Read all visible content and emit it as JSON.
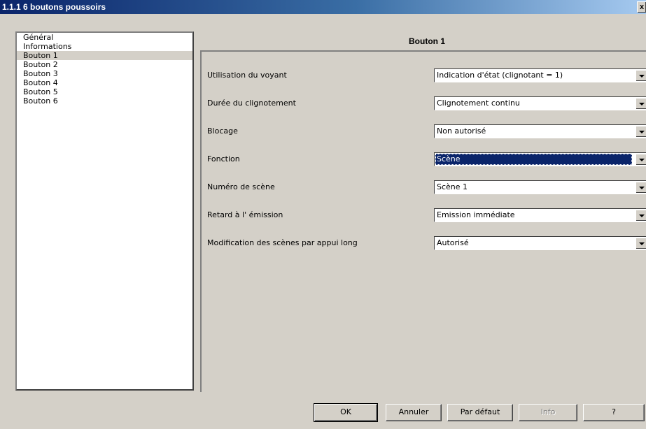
{
  "window": {
    "title": "1.1.1 6 boutons poussoirs",
    "close_label": "x"
  },
  "nav": {
    "items": [
      "Général",
      "Informations",
      "Bouton 1",
      "Bouton 2",
      "Bouton 3",
      "Bouton 4",
      "Bouton 5",
      "Bouton 6"
    ],
    "selected": "Bouton 1"
  },
  "panel": {
    "title": "Bouton 1",
    "params": [
      {
        "label": "Utilisation du voyant",
        "value": "Indication d'état (clignotant = 1)"
      },
      {
        "label": "Durée du clignotement",
        "value": "Clignotement continu"
      },
      {
        "label": "Blocage",
        "value": "Non autorisé"
      },
      {
        "label": "Fonction",
        "value": "Scène"
      },
      {
        "label": "Numéro de scène",
        "value": "Scène 1"
      },
      {
        "label": "Retard à l' émission",
        "value": "Emission immédiate"
      },
      {
        "label": "Modification des scènes par appui long",
        "value": "Autorisé"
      }
    ]
  },
  "buttons": {
    "ok": "OK",
    "cancel": "Annuler",
    "default": "Par défaut",
    "info": "Info",
    "help": "?"
  }
}
